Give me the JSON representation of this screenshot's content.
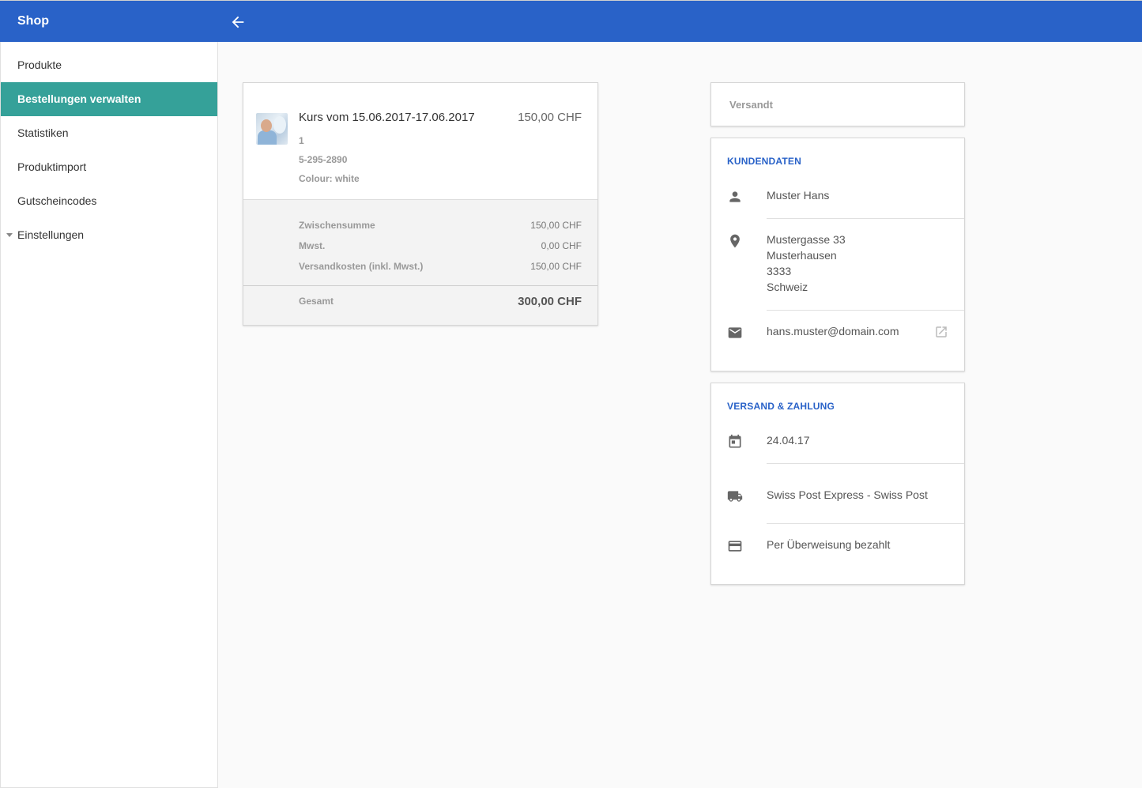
{
  "app": {
    "title": "Shop"
  },
  "sidebar": {
    "items": [
      {
        "label": "Produkte"
      },
      {
        "label": "Bestellungen verwalten"
      },
      {
        "label": "Statistiken"
      },
      {
        "label": "Produktimport"
      },
      {
        "label": "Gutscheincodes"
      },
      {
        "label": "Einstellungen"
      }
    ]
  },
  "order": {
    "item": {
      "title": "Kurs vom 15.06.2017-17.06.2017",
      "price": "150,00 CHF",
      "quantity": "1",
      "sku": "5-295-2890",
      "variant": "Colour: white"
    },
    "summary": {
      "subtotal_label": "Zwischensumme",
      "subtotal_value": "150,00 CHF",
      "vat_label": "Mwst.",
      "vat_value": "0,00 CHF",
      "shipping_label": "Versandkosten (inkl. Mwst.)",
      "shipping_value": "150,00 CHF",
      "total_label": "Gesamt",
      "total_value": "300,00 CHF"
    }
  },
  "status": {
    "label": "Versandt"
  },
  "customer": {
    "section_title": "KUNDENDATEN",
    "name": "Muster Hans",
    "address_lines": [
      "Mustergasse 33",
      "Musterhausen",
      "3333",
      "Schweiz"
    ],
    "email": "hans.muster@domain.com"
  },
  "shipping": {
    "section_title": "VERSAND & ZAHLUNG",
    "date": "24.04.17",
    "method": "Swiss Post Express - Swiss Post",
    "payment": "Per Überweisung bezahlt"
  },
  "icons": {
    "back": "arrow-left-icon",
    "person": "person-icon",
    "location": "location-pin-icon",
    "email": "envelope-icon",
    "external": "open-in-new-icon",
    "date": "calendar-icon",
    "shipping": "truck-icon",
    "payment": "credit-card-icon"
  },
  "colors": {
    "header": "#2962c8",
    "active_nav": "#35a199",
    "section_title": "#2962c8"
  }
}
